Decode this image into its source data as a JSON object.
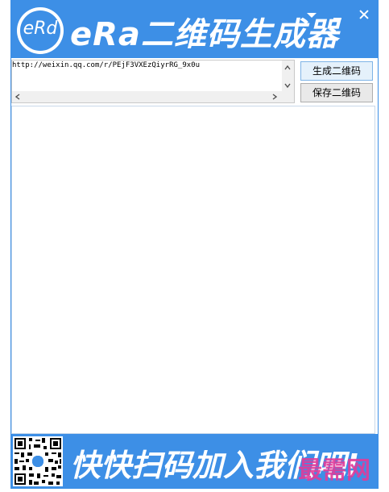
{
  "app": {
    "logo_text": "eRd",
    "title": "eRa二维码生成器"
  },
  "input": {
    "value": "http://weixin.qq.com/r/PEjF3VXEzQiyrRG_9x0u"
  },
  "buttons": {
    "generate": "生成二维码",
    "save": "保存二维码"
  },
  "footer": {
    "text": "快快扫码加入我们吧!",
    "watermark": "最需网"
  },
  "colors": {
    "brand_blue": "#3d8fe6",
    "watermark": "#e23b9a"
  },
  "icons": {
    "minimize": "minimize-icon",
    "close": "close-icon",
    "menu": "menu-arrow-icon"
  }
}
